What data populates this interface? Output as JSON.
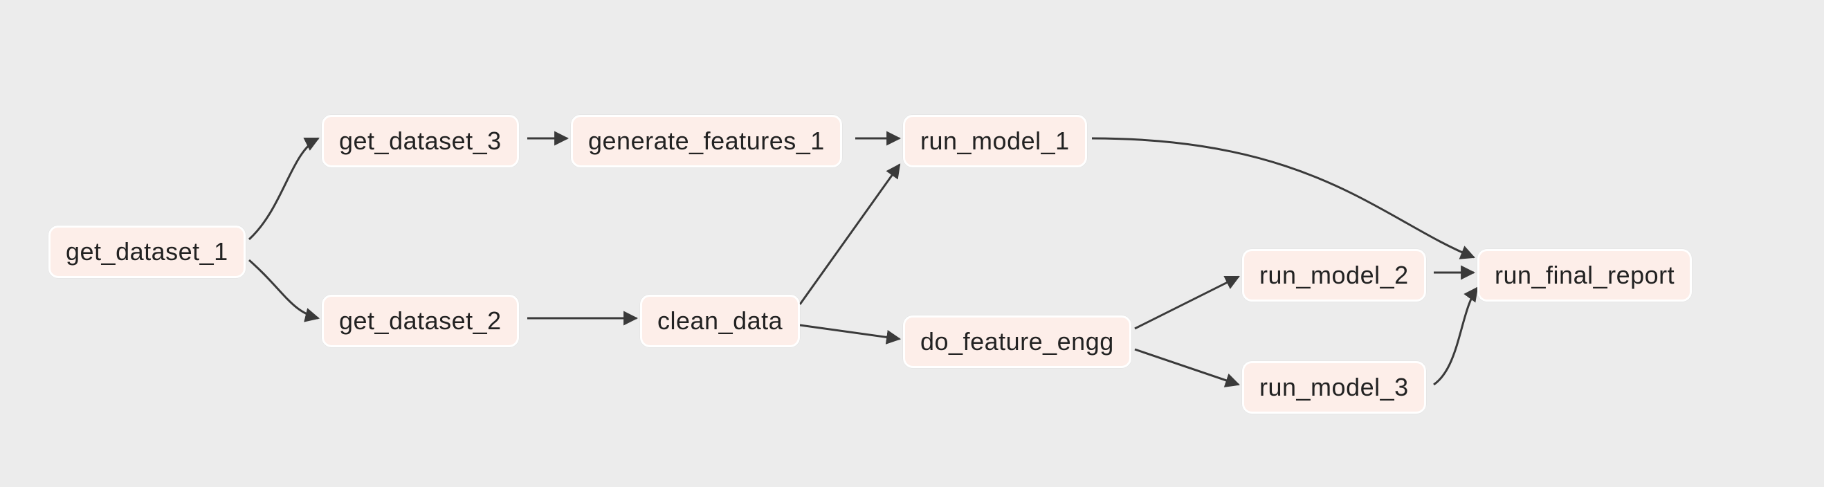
{
  "diagram": {
    "type": "dag",
    "nodes": {
      "get_dataset_1": {
        "label": "get_dataset_1"
      },
      "get_dataset_3": {
        "label": "get_dataset_3"
      },
      "get_dataset_2": {
        "label": "get_dataset_2"
      },
      "generate_features_1": {
        "label": "generate_features_1"
      },
      "clean_data": {
        "label": "clean_data"
      },
      "run_model_1": {
        "label": "run_model_1"
      },
      "do_feature_engg": {
        "label": "do_feature_engg"
      },
      "run_model_2": {
        "label": "run_model_2"
      },
      "run_model_3": {
        "label": "run_model_3"
      },
      "run_final_report": {
        "label": "run_final_report"
      }
    },
    "edges": [
      {
        "from": "get_dataset_1",
        "to": "get_dataset_3"
      },
      {
        "from": "get_dataset_1",
        "to": "get_dataset_2"
      },
      {
        "from": "get_dataset_3",
        "to": "generate_features_1"
      },
      {
        "from": "get_dataset_2",
        "to": "clean_data"
      },
      {
        "from": "generate_features_1",
        "to": "run_model_1"
      },
      {
        "from": "clean_data",
        "to": "run_model_1"
      },
      {
        "from": "clean_data",
        "to": "do_feature_engg"
      },
      {
        "from": "do_feature_engg",
        "to": "run_model_2"
      },
      {
        "from": "do_feature_engg",
        "to": "run_model_3"
      },
      {
        "from": "run_model_1",
        "to": "run_final_report"
      },
      {
        "from": "run_model_2",
        "to": "run_final_report"
      },
      {
        "from": "run_model_3",
        "to": "run_final_report"
      }
    ],
    "colors": {
      "node_fill": "#fdeee9",
      "node_border": "#ffffff",
      "edge": "#3a3a3a",
      "background": "#ececec"
    }
  }
}
